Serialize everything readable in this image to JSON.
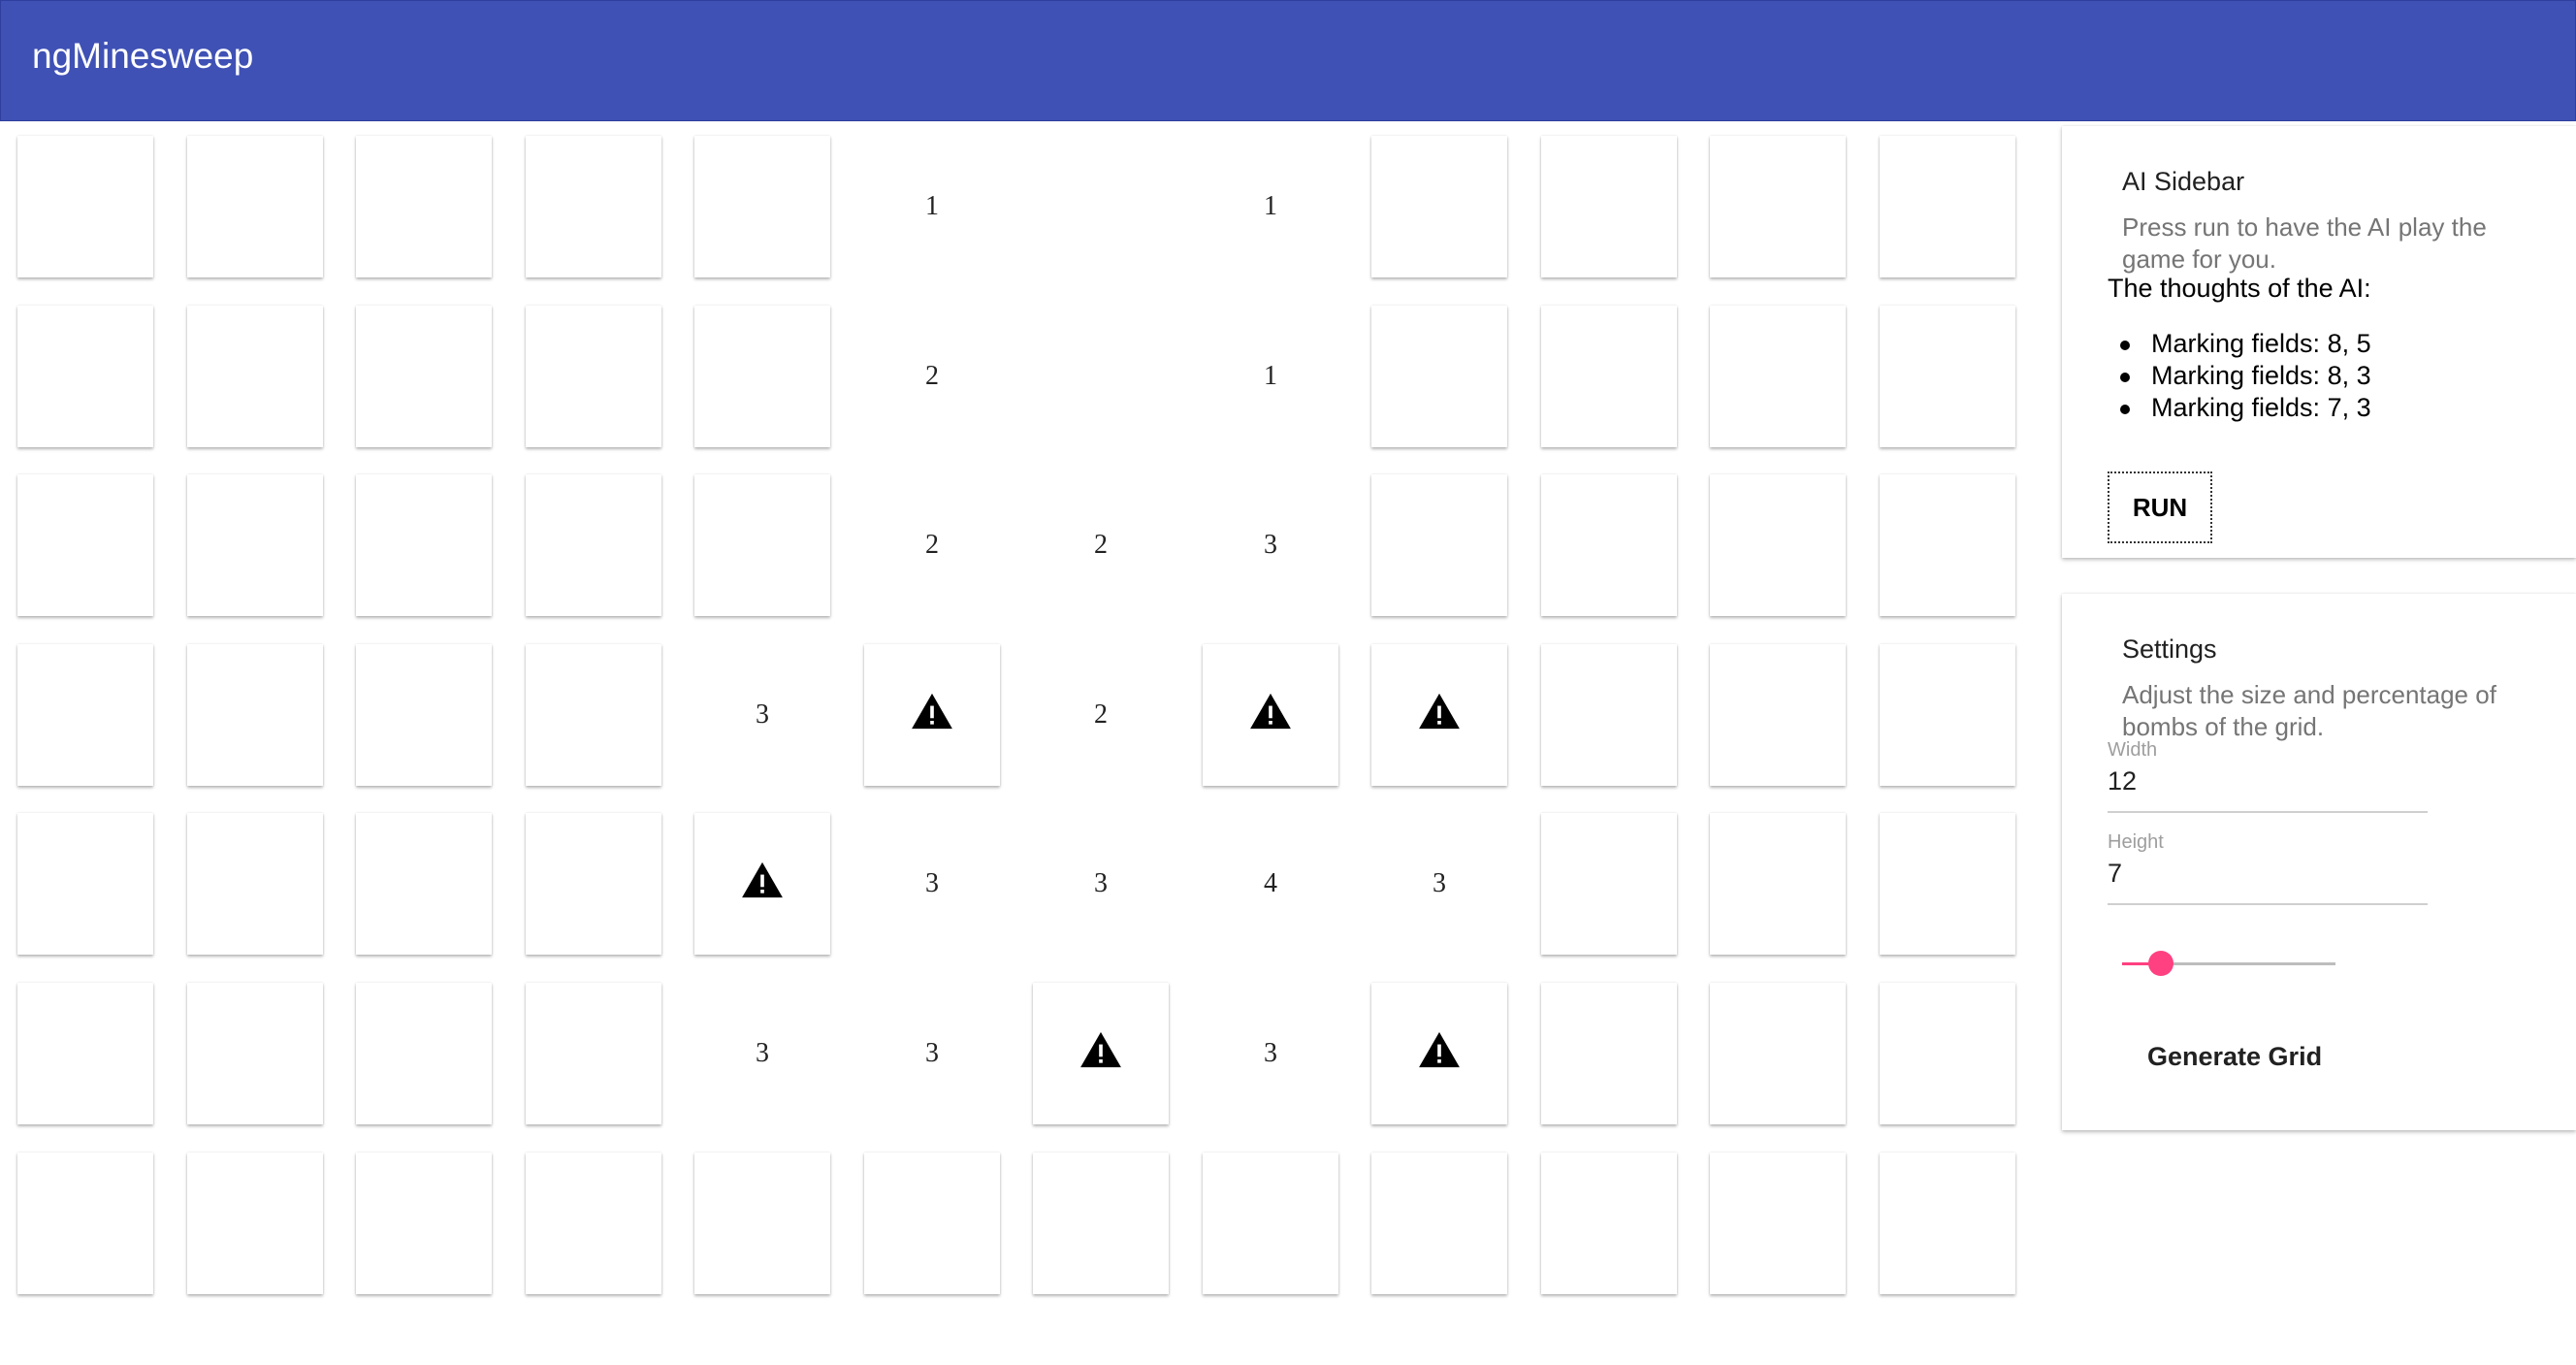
{
  "toolbar": {
    "title": "ngMinesweep",
    "color": "#3f51b5"
  },
  "board": {
    "width": 12,
    "height": 7,
    "legend": "C = covered, F = flagged bomb, . = revealed empty, digit = revealed number",
    "rows": [
      [
        "C",
        "C",
        "C",
        "C",
        "C",
        "1",
        ".",
        "1",
        "C",
        "C",
        "C",
        "C"
      ],
      [
        "C",
        "C",
        "C",
        "C",
        "C",
        "2",
        ".",
        "1",
        "C",
        "C",
        "C",
        "C"
      ],
      [
        "C",
        "C",
        "C",
        "C",
        "C",
        "2",
        "2",
        "3",
        "C",
        "C",
        "C",
        "C"
      ],
      [
        "C",
        "C",
        "C",
        "C",
        "3",
        "F",
        "2",
        "F",
        "F",
        "C",
        "C",
        "C"
      ],
      [
        "C",
        "C",
        "C",
        "C",
        "F",
        "3",
        "3",
        "4",
        "3",
        "C",
        "C",
        "C"
      ],
      [
        "C",
        "C",
        "C",
        "C",
        "3",
        "3",
        "F",
        "3",
        "F",
        "C",
        "C",
        "C"
      ],
      [
        "C",
        "C",
        "C",
        "C",
        "C",
        "C",
        "C",
        "C",
        "C",
        "C",
        "C",
        "C"
      ]
    ],
    "flag_icon": "warning-icon"
  },
  "ai_sidebar": {
    "title": "AI Sidebar",
    "subtitle": "Press run to have the AI play the game for you.",
    "thoughts_heading": "The thoughts of the AI:",
    "thoughts": [
      "Marking fields: 8, 5",
      "Marking fields: 8, 3",
      "Marking fields: 7, 3"
    ],
    "run_label": "RUN"
  },
  "settings": {
    "title": "Settings",
    "subtitle": "Adjust the size and percentage of bombs of the grid.",
    "width_label": "Width",
    "width_value": "12",
    "height_label": "Height",
    "height_value": "7",
    "bomb_percentage": 0.18,
    "slider_color": "#ff4081",
    "generate_label": "Generate Grid"
  }
}
